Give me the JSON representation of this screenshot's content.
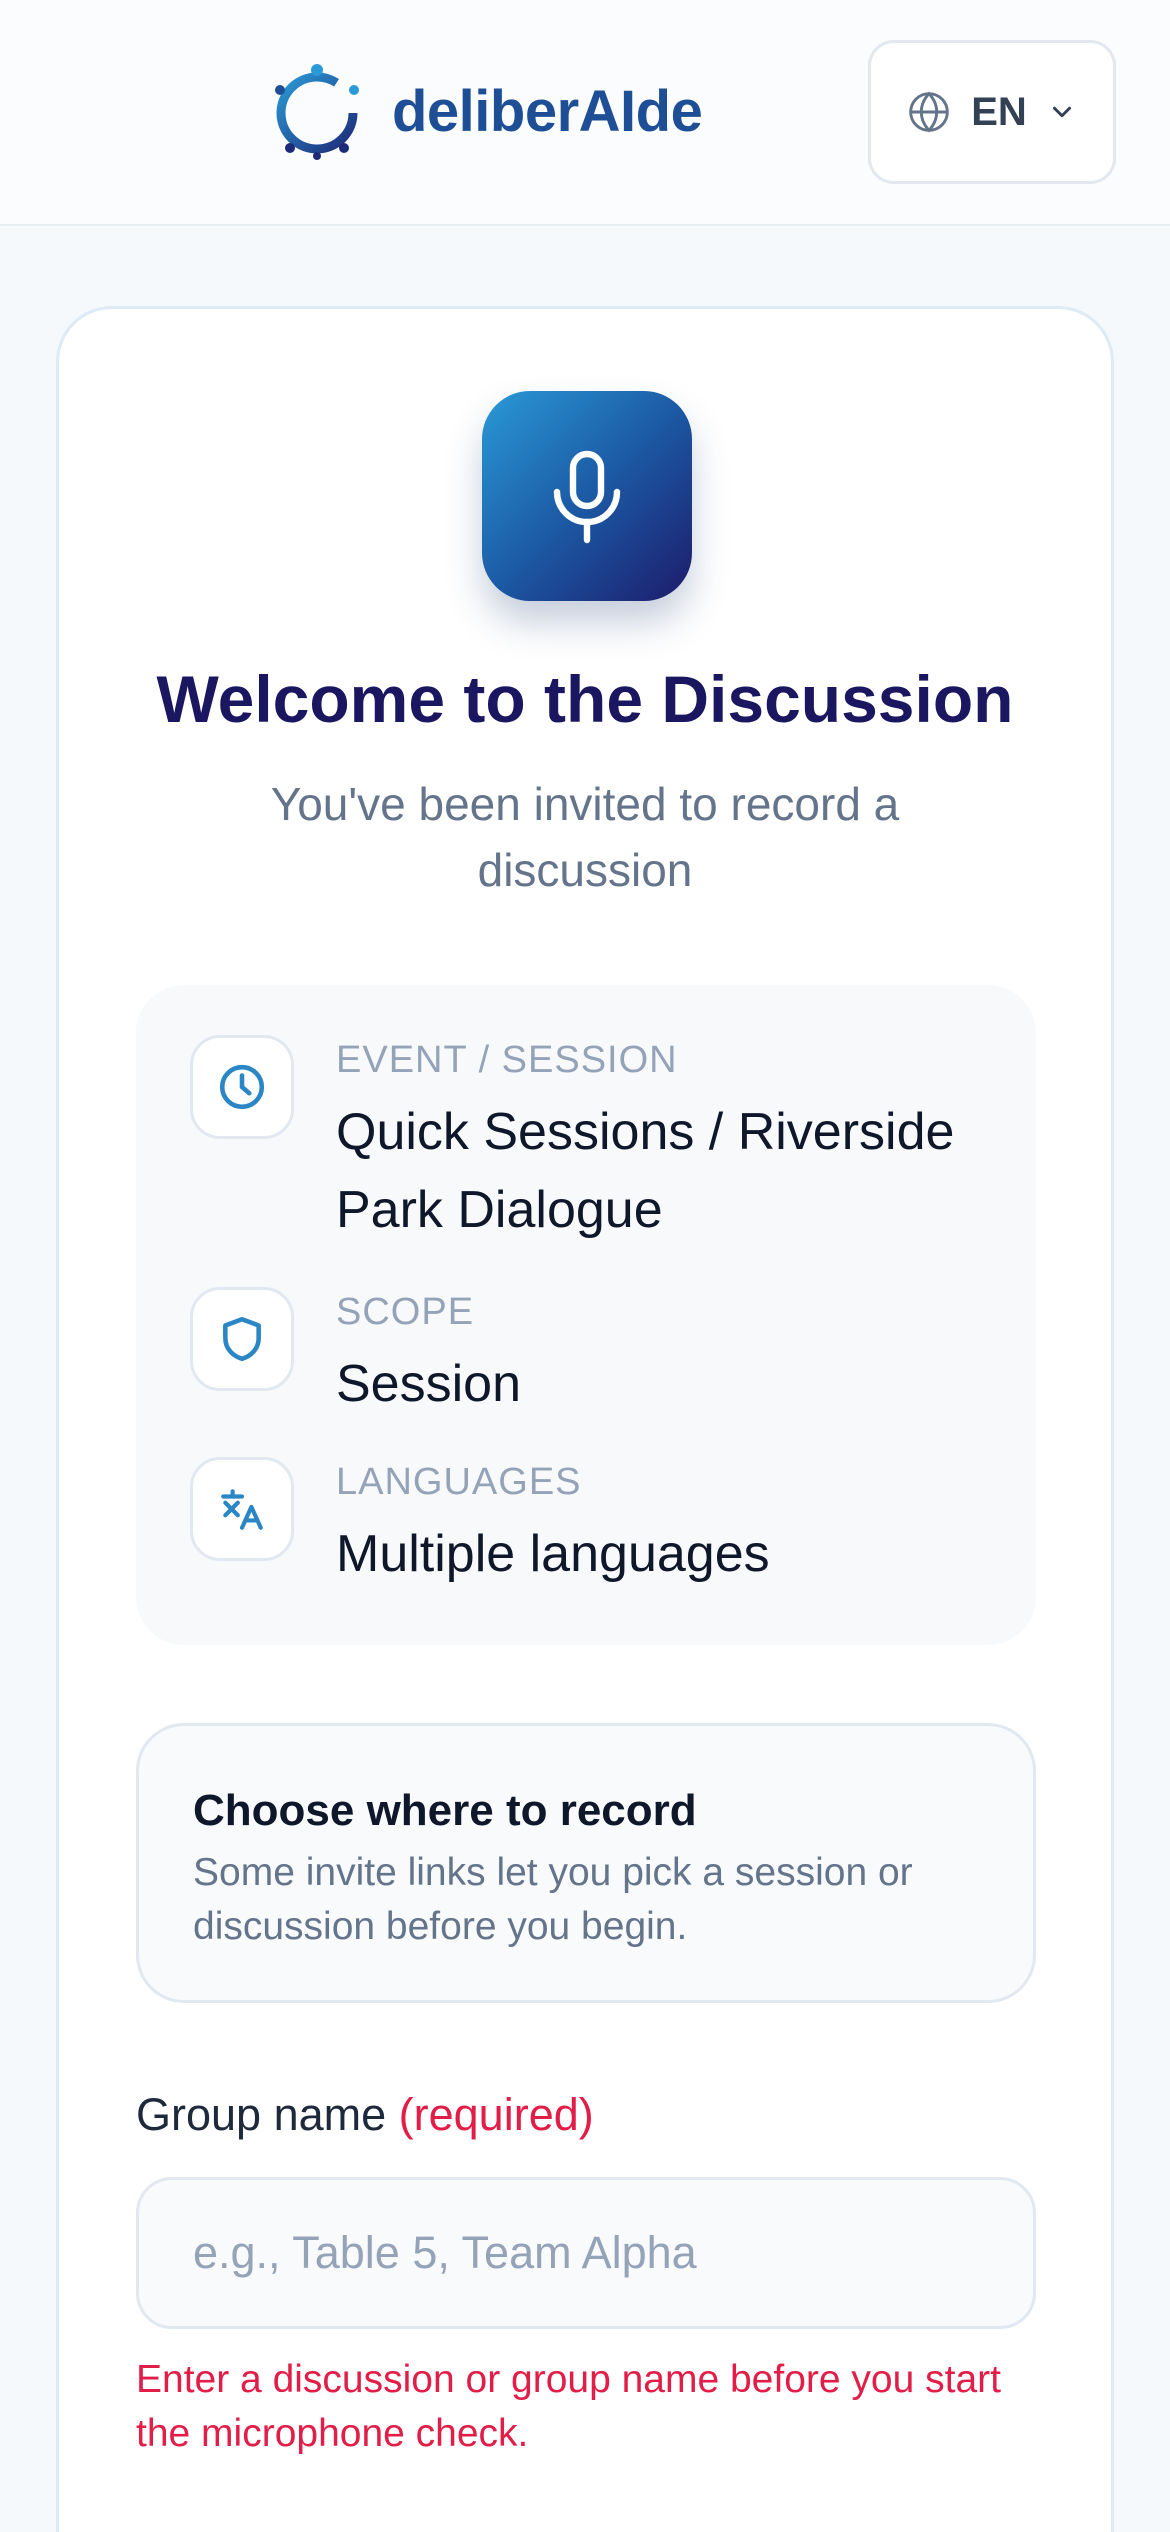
{
  "header": {
    "brand": "deliberAIde",
    "language": {
      "code": "EN",
      "icon": "globe-icon"
    }
  },
  "welcome": {
    "title": "Welcome to the Discussion",
    "subtitle": "You've been invited to record a discussion"
  },
  "info": [
    {
      "label": "EVENT / SESSION",
      "value": "Quick Sessions / Riverside Park Dialogue",
      "icon": "clock-icon"
    },
    {
      "label": "SCOPE",
      "value": "Session",
      "icon": "shield-icon"
    },
    {
      "label": "LANGUAGES",
      "value": "Multiple languages",
      "icon": "translate-icon"
    }
  ],
  "choose": {
    "title": "Choose where to record",
    "description": "Some invite links let you pick a session or discussion before you begin."
  },
  "group_name": {
    "label": "Group name",
    "required_text": "(required)",
    "placeholder": "e.g., Table 5, Team Alpha",
    "value": "",
    "error": "Enter a discussion or group name before you start the microphone check."
  },
  "colors": {
    "brand": "#1e4f96",
    "title": "#1a1760",
    "accent": "#2a86c4",
    "error": "#e11d48"
  }
}
